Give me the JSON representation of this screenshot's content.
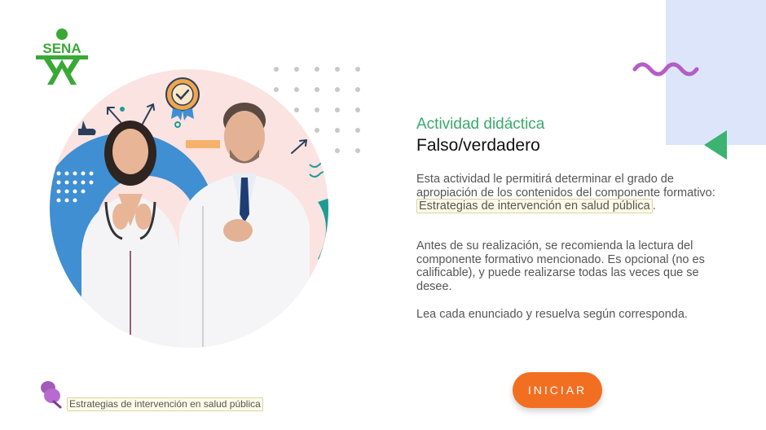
{
  "logo": {
    "text": "SENA"
  },
  "activity": {
    "label": "Actividad didáctica",
    "title": "Falso/verdadero"
  },
  "description": {
    "p1_before": "Esta actividad le permitirá determinar el grado de apropiación de los contenidos del componente formativo: ",
    "p1_link": "Estrategias de intervención en salud pública",
    "p1_after": ".",
    "p2": "Antes de su realización, se recomienda la lectura del componente formativo mencionado. Es opcional (no es calificable), y puede realizarse todas las veces que se desee.",
    "p3": "Lea cada enunciado y resuelva según corresponda."
  },
  "button": {
    "start_label": "INICIAR"
  },
  "footer": {
    "link_label": "Estrategias de intervención en salud pública"
  },
  "colors": {
    "accent_green": "#39a96b",
    "button_orange": "#f26f22",
    "panel_blue": "#dde5fb",
    "squiggle_purple": "#b45cc8",
    "highlight_bg": "#fdfbe7"
  },
  "icons": [
    "sena-logo",
    "squiggle-decoration",
    "triangle-decoration",
    "pushpin-icon",
    "badge-check-icon"
  ]
}
